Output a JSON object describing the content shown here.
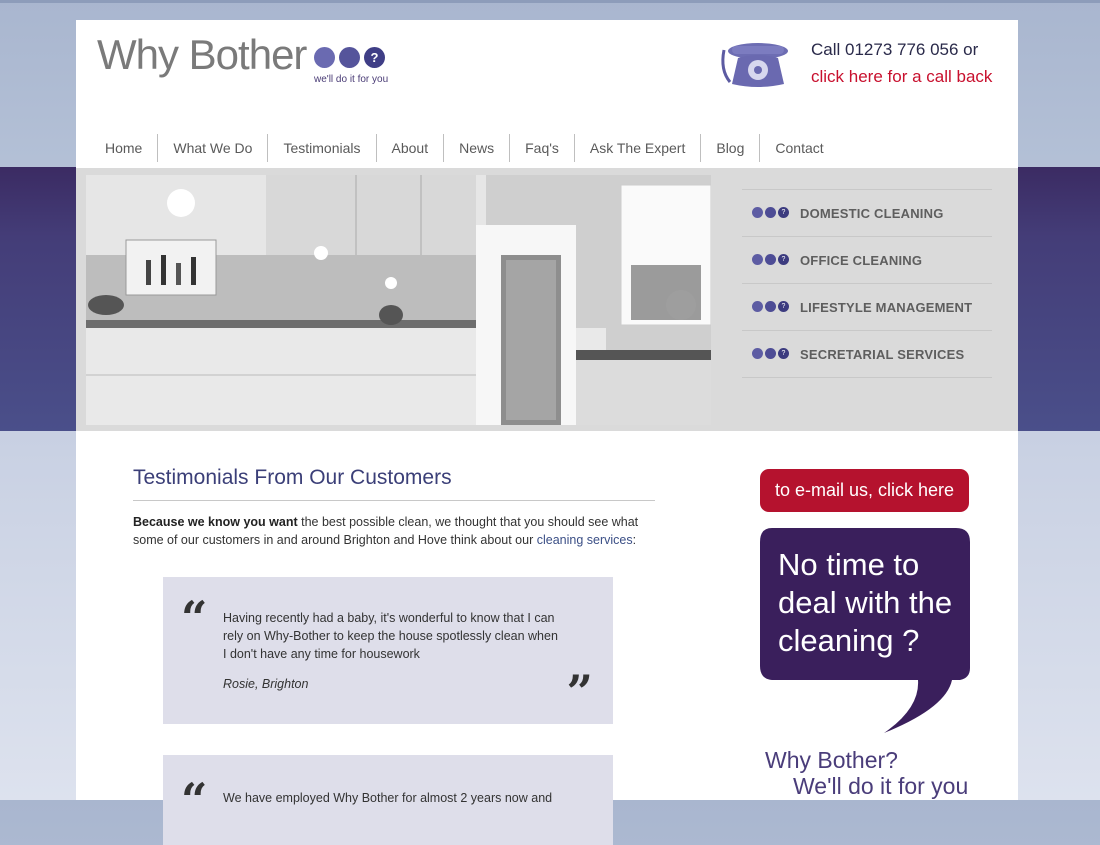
{
  "header": {
    "logo_text": "Why Bother",
    "logo_mark": "?",
    "tagline": "we'll do it for you",
    "call_text": "Call 01273 776 056 or",
    "callback_link": "click here for a call back"
  },
  "nav": {
    "items": [
      "Home",
      "What We Do",
      "Testimonials",
      "About",
      "News",
      "Faq's",
      "Ask The Expert",
      "Blog",
      "Contact"
    ]
  },
  "services": {
    "items": [
      "DOMESTIC CLEANING",
      "OFFICE CLEANING",
      "LIFESTYLE MANAGEMENT",
      "SECRETARIAL SERVICES"
    ]
  },
  "main": {
    "heading": "Testimonials From Our Customers",
    "intro_bold": "Because we know you want",
    "intro_text": " the best possible clean, we thought that you should see what some of our customers in and around Brighton and Hove think about our ",
    "intro_link": "cleaning services",
    "intro_end": ":",
    "testimonials": [
      {
        "text": "Having recently had a baby, it's wonderful to know that I can rely on Why-Bother to keep the house spotlessly clean when I don't have any time for housework",
        "author": "Rosie, Brighton"
      },
      {
        "text": "We have employed Why Bother for almost 2 years now and"
      }
    ],
    "open_quote": "“",
    "close_quote": "”"
  },
  "sidebar": {
    "email_button": "to e-mail us, click here",
    "bubble_text": "No time to deal with the cleaning ?",
    "slogan_line1": "Why Bother?",
    "slogan_line2": "We'll do it for you"
  },
  "colors": {
    "brand_purple": "#3b2b63",
    "accent_red": "#b5122e",
    "bubble_purple": "#3a1f5c",
    "link_red": "#c8102e"
  }
}
